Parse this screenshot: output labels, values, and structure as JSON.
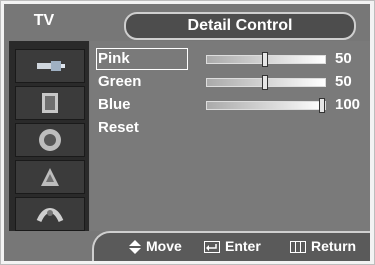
{
  "header": {
    "source_label": "TV",
    "title": "Detail Control"
  },
  "sidebar": {
    "items": [
      {
        "icon": "input-icon"
      },
      {
        "icon": "picture-icon"
      },
      {
        "icon": "sound-icon"
      },
      {
        "icon": "channel-icon"
      },
      {
        "icon": "setup-icon"
      }
    ]
  },
  "settings": [
    {
      "label": "Pink",
      "value": "50",
      "level": 0.5,
      "selected": true
    },
    {
      "label": "Green",
      "value": "50",
      "level": 0.5,
      "selected": false
    },
    {
      "label": "Blue",
      "value": "100",
      "level": 1.0,
      "selected": false
    },
    {
      "label": "Reset",
      "value": null,
      "level": null,
      "selected": false
    }
  ],
  "help": {
    "move": "Move",
    "enter": "Enter",
    "return": "Return"
  },
  "colors": {
    "panel": "#7a7a7a",
    "sidebar": "#2a2a2a",
    "text": "#ffffff"
  }
}
